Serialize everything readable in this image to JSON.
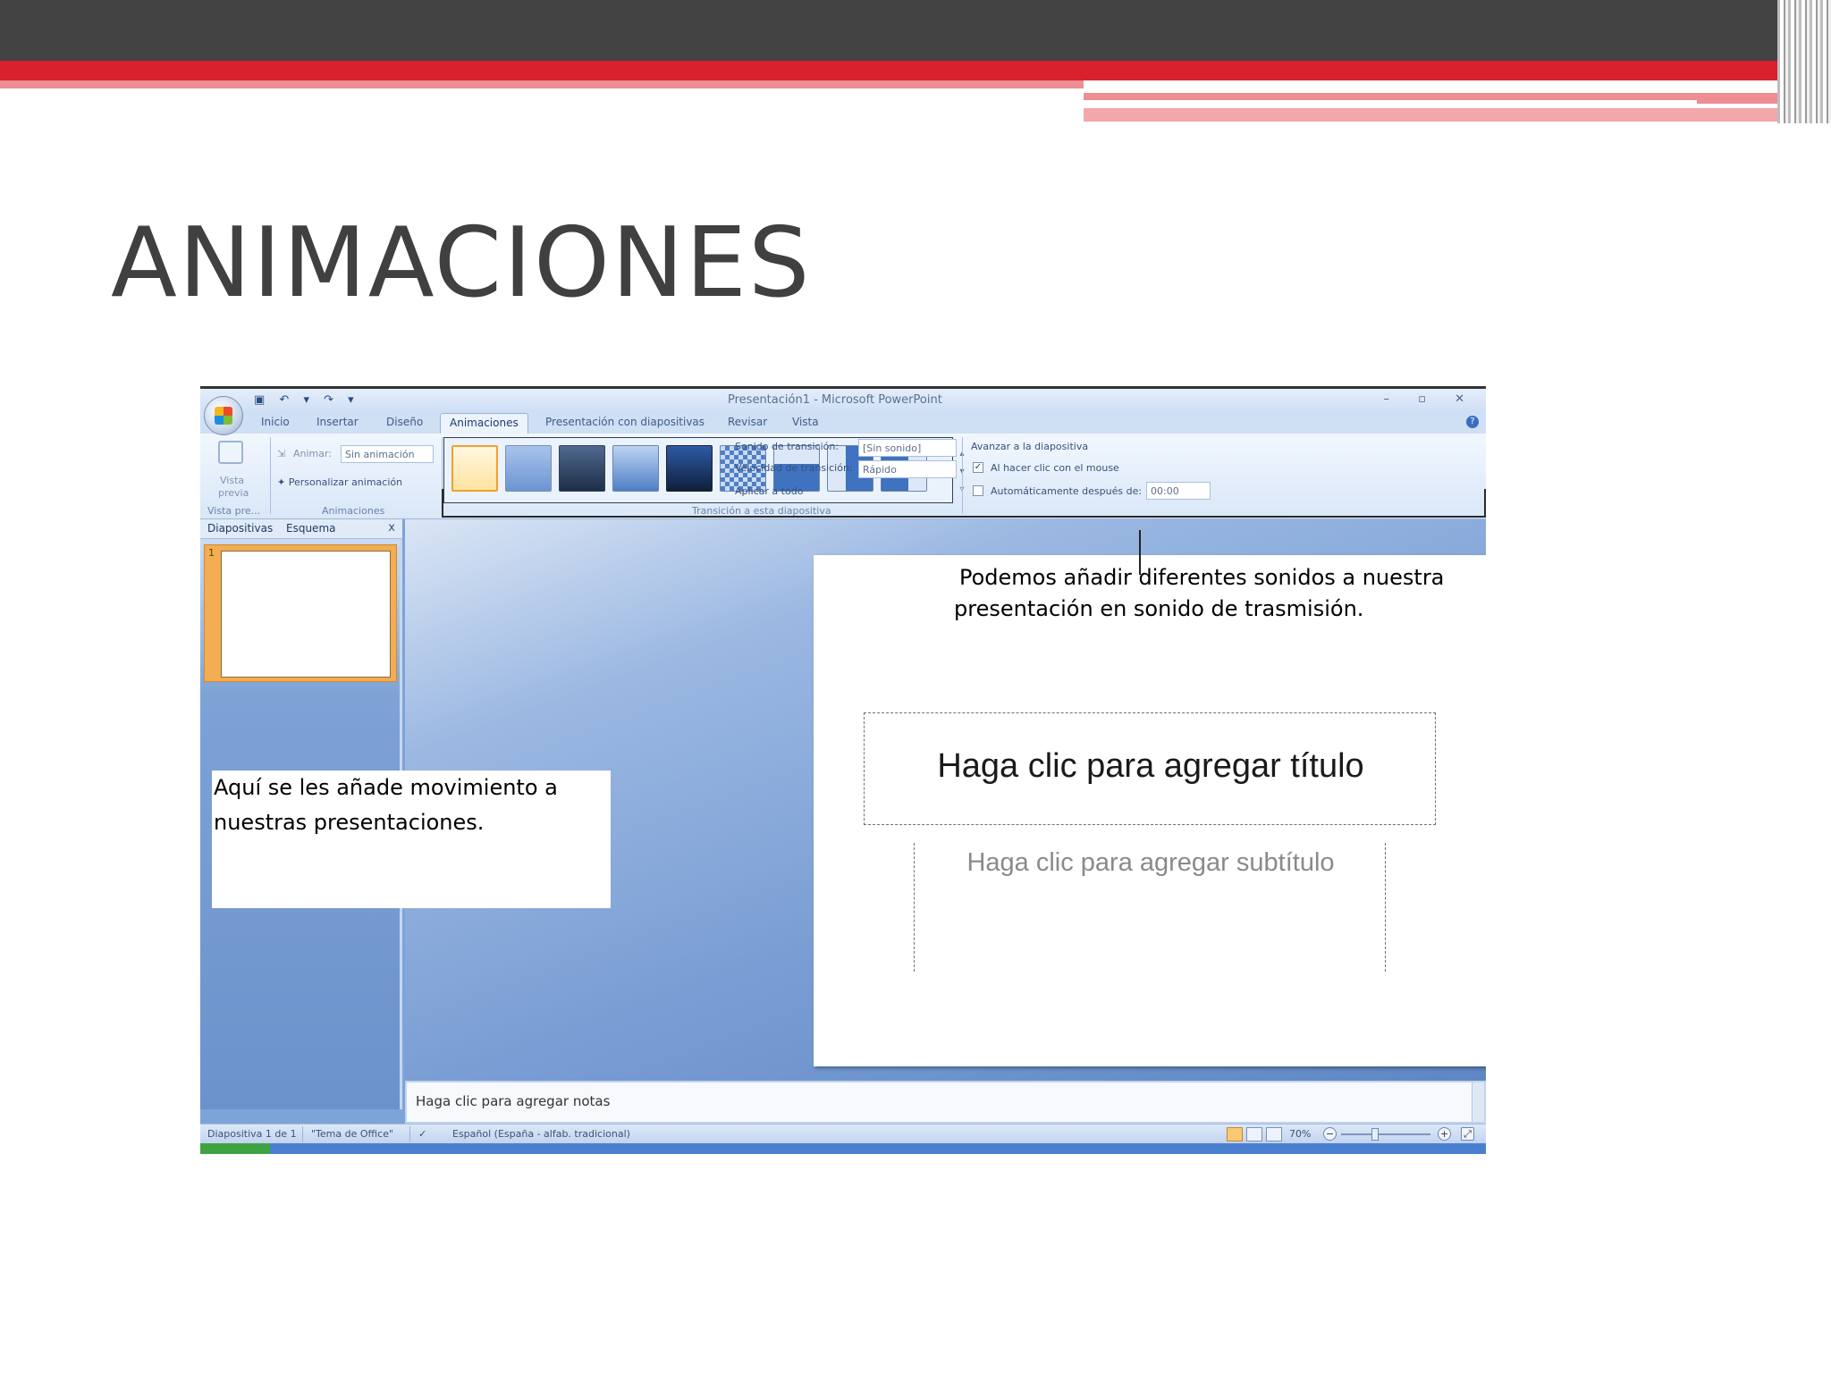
{
  "slide": {
    "title": "ANIMACIONES"
  },
  "window": {
    "title": "Presentación1 - Microsoft PowerPoint",
    "qat": "▣ ↶ ▾ ↷ ▾",
    "controls": "– ▫ ✕"
  },
  "tabs": [
    "Inicio",
    "Insertar",
    "Diseño",
    "Animaciones",
    "Presentación con diapositivas",
    "Revisar",
    "Vista"
  ],
  "active_tab": "Animaciones",
  "ribbon": {
    "vista_previa": {
      "label_line1": "Vista",
      "label_line2": "previa",
      "group": "Vista pre..."
    },
    "animaciones": {
      "animar_label": "Animar:",
      "animar_value": "Sin animación",
      "personalizar": "Personalizar animación",
      "group": "Animaciones"
    },
    "transicion": {
      "sonido_label": "Sonido de transición:",
      "sonido_value": "[Sin sonido]",
      "velocidad_label": "Velocidad de transición:",
      "velocidad_value": "Rápido",
      "aplicar_todo": "Aplicar a todo",
      "group": "Transición a esta diapositiva"
    },
    "avanzar": {
      "heading": "Avanzar a la diapositiva",
      "on_click": "Al hacer clic con el mouse",
      "on_click_checked": true,
      "auto": "Automáticamente después de:",
      "auto_checked": false,
      "auto_value": "00:00"
    }
  },
  "slides_panel": {
    "tab1": "Diapositivas",
    "tab2": "Esquema",
    "close": "x",
    "thumb_number": "1"
  },
  "current_slide": {
    "title_placeholder": "Haga clic para agregar título",
    "subtitle_placeholder": "Haga clic para agregar subtítulo"
  },
  "notes_placeholder": "Haga clic para agregar notas",
  "statusbar": {
    "slide_info": "Diapositiva 1 de 1",
    "theme": "\"Tema de Office\"",
    "language": "Español (España - alfab. tradicional)",
    "zoom": "70%"
  },
  "annotations": {
    "top_line1": "Podemos añadir diferentes sonidos a nuestra",
    "top_line2": "presentación en sonido de trasmisión.",
    "left_line1": "Aquí se les añade movimiento a",
    "left_line2": "nuestras presentaciones."
  },
  "colors": {
    "header_dark": "#434343",
    "accent_red": "#d9202d",
    "accent_pink": "#ee8d93",
    "office_blue": "#7ea3d8"
  }
}
